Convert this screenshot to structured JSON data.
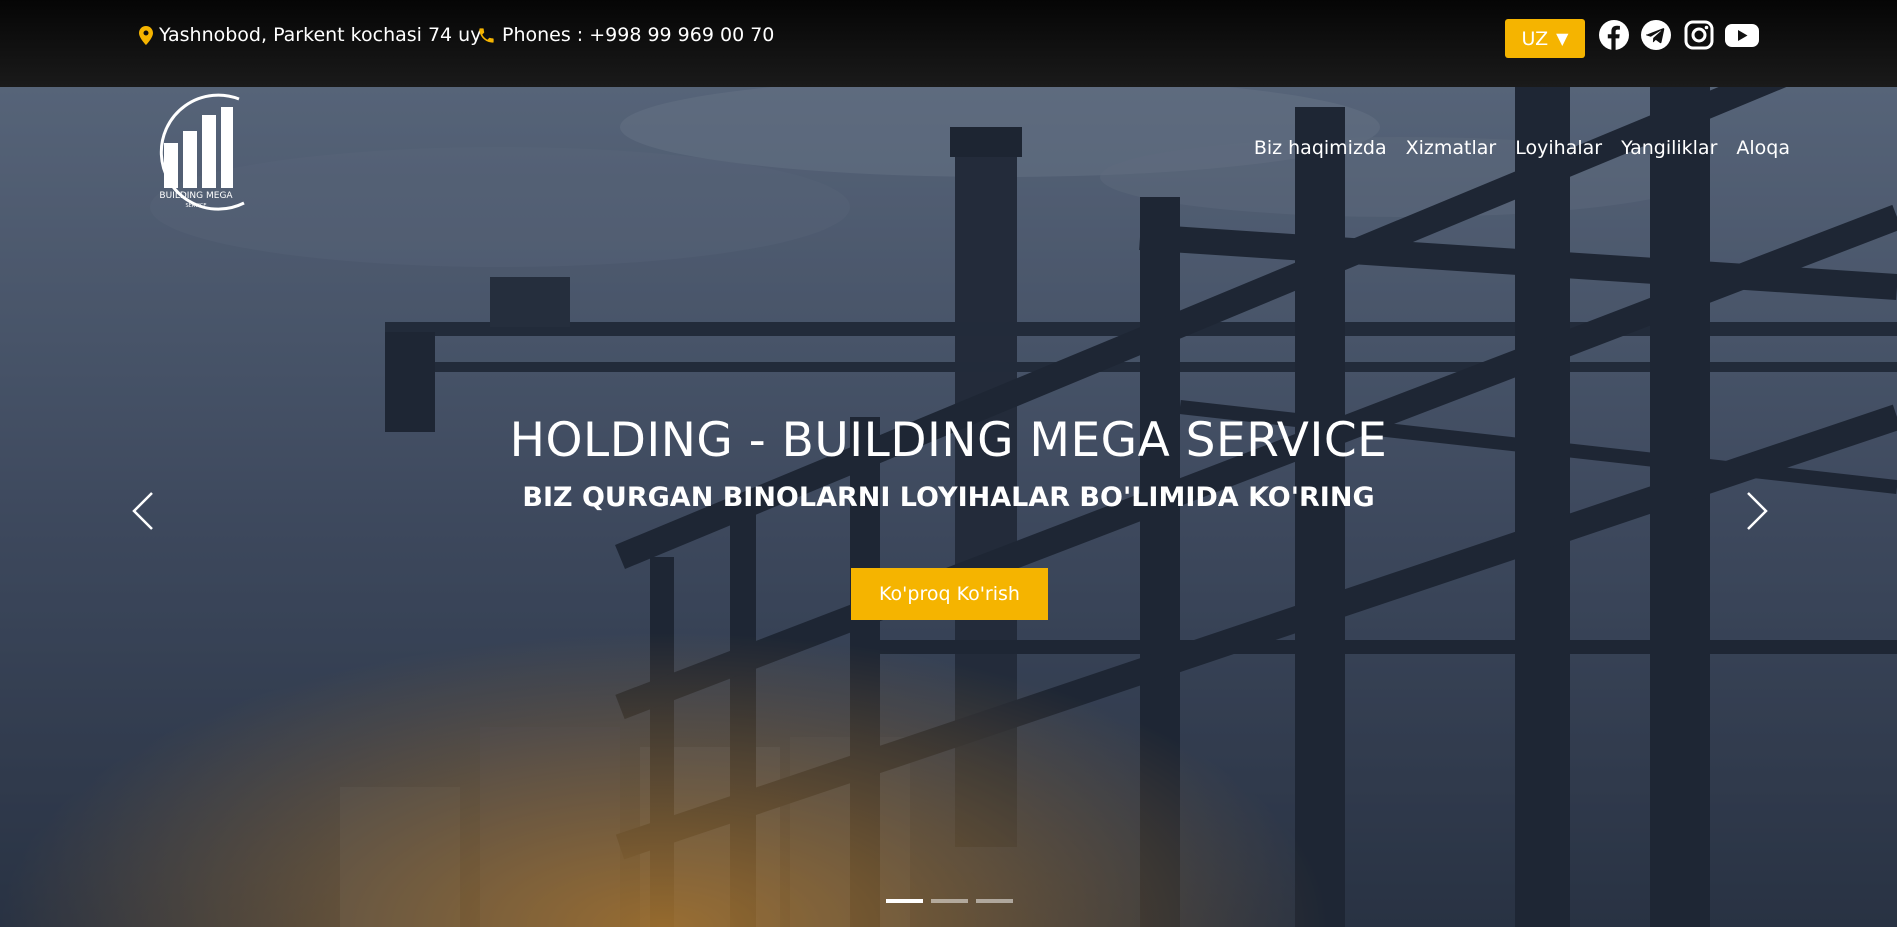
{
  "topbar": {
    "address": "Yashnobod, Parkent kochasi 74 uy",
    "phone": "Phones : +998 99 969 00 70",
    "language": "UZ",
    "accent_color": "#f5b400",
    "social": [
      "facebook-icon",
      "telegram-icon",
      "instagram-icon",
      "youtube-icon"
    ]
  },
  "nav": {
    "items": [
      "Biz haqimizda",
      "Xizmatlar",
      "Loyihalar",
      "Yangiliklar",
      "Aloqa"
    ]
  },
  "hero": {
    "title": "HOLDING - BUILDING MEGA SERVICE",
    "subtitle": "BIZ QURGAN BINOLARNI LOYIHALAR BO'LIMIDA KO'RING",
    "cta": "Ko'proq Ko'rish",
    "slides": 3,
    "active_slide": 1
  },
  "logo": {
    "line1": "BUILDING MEGA",
    "line2": "SERVICE"
  }
}
